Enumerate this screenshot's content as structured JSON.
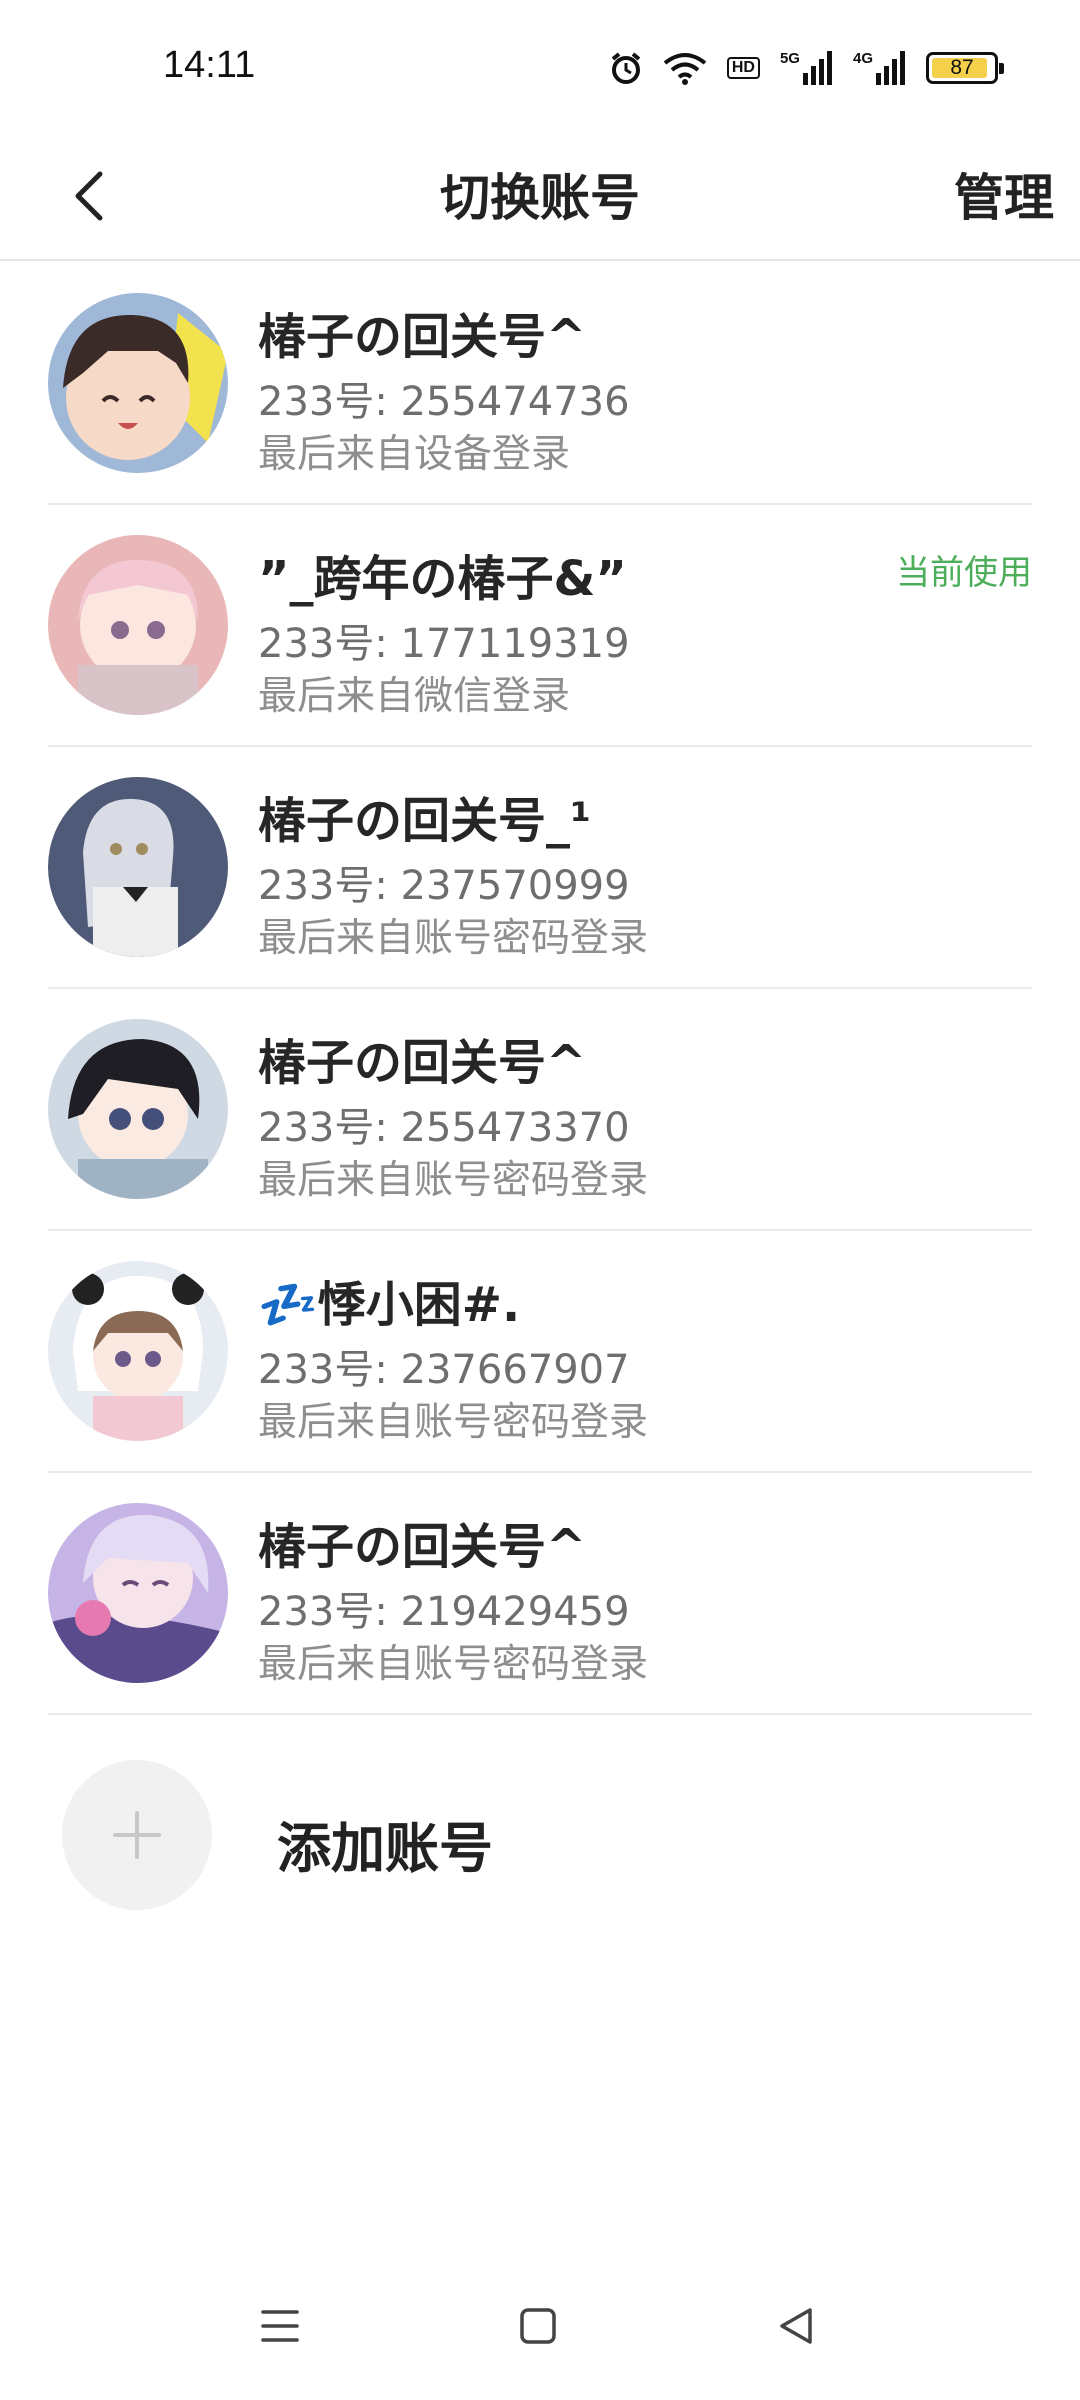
{
  "status_bar": {
    "time": "14:11",
    "network_1": "5G",
    "network_2": "4G",
    "battery": "87",
    "hd_label": "HD"
  },
  "header": {
    "title": "切换账号",
    "manage_label": "管理"
  },
  "accounts": [
    {
      "name": "椿子の回关号^",
      "id_text": "233号: 255474736",
      "login_text": "最后来自设备登录",
      "badge": ""
    },
    {
      "name": "”_跨年の椿子&”",
      "id_text": "233号: 177119319",
      "login_text": "最后来自微信登录",
      "badge": "当前使用"
    },
    {
      "name": "椿子の回关号_¹",
      "id_text": "233号: 237570999",
      "login_text": "最后来自账号密码登录",
      "badge": ""
    },
    {
      "name": "椿子の回关号^",
      "id_text": "233号: 255473370",
      "login_text": "最后来自账号密码登录",
      "badge": ""
    },
    {
      "name": "💤悸小困#.",
      "id_text": "233号: 237667907",
      "login_text": "最后来自账号密码登录",
      "badge": ""
    },
    {
      "name": "椿子の回关号^",
      "id_text": "233号: 219429459",
      "login_text": "最后来自账号密码登录",
      "badge": ""
    }
  ],
  "add_account": {
    "label": "添加账号"
  },
  "colors": {
    "accent_green": "#4cae5a",
    "battery_fill": "#f5d04a"
  },
  "icons": {
    "back": "chevron-left-icon",
    "add": "plus-icon",
    "nav_menu": "menu-icon",
    "nav_home": "home-square-icon",
    "nav_back": "triangle-back-icon"
  }
}
